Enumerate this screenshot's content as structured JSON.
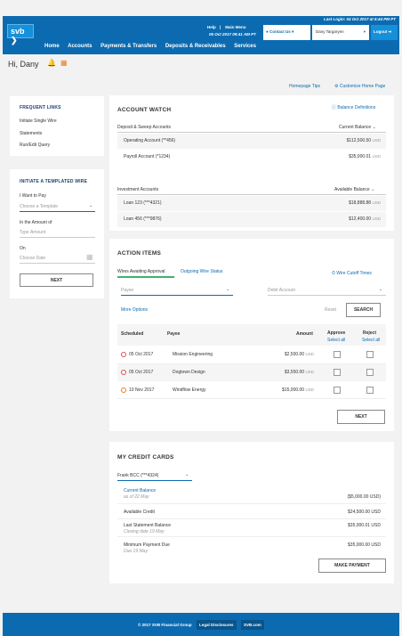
{
  "header": {
    "logo": "svb",
    "last_login": "Last Login: 04 Oct 2017 at 5:44 PM PT",
    "help": "Help",
    "main_menu": "Main Menu",
    "datetime": "05 Oct 2017 09:41 AM PT",
    "contact_us": "Contact Us",
    "user": "Dany Targaryen",
    "logout": "Logout",
    "nav": [
      "Home",
      "Accounts",
      "Payments & Transfers",
      "Deposits & Receivables",
      "Services"
    ]
  },
  "greeting": "Hi, Dany",
  "top_links": {
    "tips": "Homepage Tips",
    "customize": "Customize Home Page"
  },
  "frequent_links": {
    "title": "FREQUENT LINKS",
    "items": [
      "Initiate Single Wire",
      "Statements",
      "Run/Edit Query"
    ]
  },
  "templated_wire": {
    "title": "INITIATE A TEMPLATED WIRE",
    "pay_label": "I Want to Pay",
    "pay_placeholder": "Choose a Template",
    "amount_label": "In the Amount of",
    "amount_placeholder": "Type Amount",
    "on_label": "On",
    "date_placeholder": "Choose Date",
    "next": "NEXT"
  },
  "account_watch": {
    "title": "ACCOUNT WATCH",
    "balance_defs": "Balance Definitions",
    "deposit_header": "Deposit & Sweep Accounts",
    "current_balance": "Current Balance",
    "deposit_rows": [
      {
        "name": "Operating Account (**456)",
        "amount": "$112,500.50",
        "cur": "USD"
      },
      {
        "name": "Payroll Account (*1234)",
        "amount": "$35,000.01",
        "cur": "USD"
      }
    ],
    "investment_header": "Investment Accounts",
    "available_balance": "Available Balance",
    "investment_rows": [
      {
        "name": "Loan 123 (***4321)",
        "amount": "$18,888.88",
        "cur": "USD"
      },
      {
        "name": "Loan 456 (***9876)",
        "amount": "$12,400.00",
        "cur": "USD"
      }
    ]
  },
  "action_items": {
    "title": "ACTION ITEMS",
    "tab_active": "Wires Awaiting Approval",
    "tab_other": "Outgoing Wire Status",
    "cutoff": "Wire Cutoff Times",
    "payee_placeholder": "Payee",
    "debit_placeholder": "Debit Account",
    "more_options": "More Options",
    "reset": "Reset",
    "search": "SEARCH",
    "col_scheduled": "Scheduled",
    "col_payee": "Payee",
    "col_amount": "Amount",
    "col_approve": "Approve",
    "col_reject": "Reject",
    "select_all": "Select all",
    "rows": [
      {
        "date": "05 Oct 2017",
        "payee": "Mission Engineering",
        "amount": "$2,500.00",
        "cur": "USD"
      },
      {
        "date": "05 Oct 2017",
        "payee": "Dogtown Design",
        "amount": "$3,550.00",
        "cur": "USD"
      },
      {
        "date": "10 Nov 2017",
        "payee": "Windflow Energy",
        "amount": "$15,000.00",
        "cur": "USD"
      }
    ],
    "next": "NEXT"
  },
  "credit_cards": {
    "title": "MY CREDIT CARDS",
    "card_select": "Frank BCC (***4324)",
    "rows": [
      {
        "label": "Current Balance",
        "sub": "as of 22 May",
        "amount": "($5,000.00 USD)"
      },
      {
        "label": "Available Credit",
        "sub": "",
        "amount": "$24,500.00 USD"
      },
      {
        "label": "Last Statement Balance",
        "sub": "Closing date 19 May",
        "amount": "$35,000.01 USD"
      },
      {
        "label": "Minimum Payment Due",
        "sub": "Due 19 May",
        "amount": "$35,000.00 USD"
      }
    ],
    "make_payment": "MAKE PAYMENT"
  },
  "footer": {
    "copyright": "© 2017 SVB Financial Group",
    "legal": "Legal Disclosures",
    "svb": "SVB.com"
  }
}
